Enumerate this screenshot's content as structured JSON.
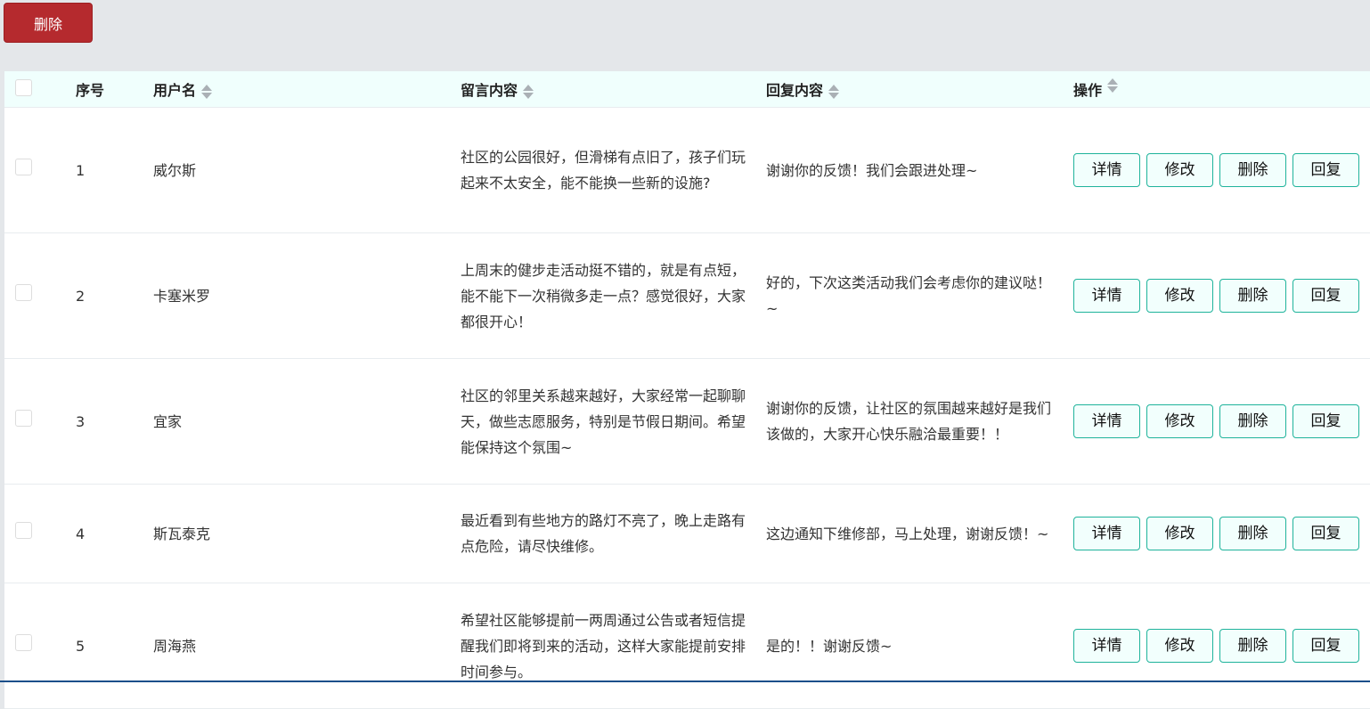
{
  "toolbar": {
    "delete_label": "删除"
  },
  "columns": {
    "index": "序号",
    "username": "用户名",
    "message": "留言内容",
    "reply": "回复内容",
    "actions": "操作"
  },
  "actions": {
    "detail": "详情",
    "edit": "修改",
    "delete": "删除",
    "reply": "回复"
  },
  "rows": [
    {
      "index": "1",
      "username": "威尔斯",
      "message": "社区的公园很好，但滑梯有点旧了，孩子们玩起来不太安全，能不能换一些新的设施?",
      "reply": "谢谢你的反馈！我们会跟进处理~",
      "height": 141
    },
    {
      "index": "2",
      "username": "卡塞米罗",
      "message": "上周末的健步走活动挺不错的，就是有点短，能不能下一次稍微多走一点？感觉很好，大家都很开心！",
      "reply": "好的，下次这类活动我们会考虑你的建议哒！~",
      "height": 141
    },
    {
      "index": "3",
      "username": "宜家",
      "message": "社区的邻里关系越来越好，大家经常一起聊聊天，做些志愿服务，特别是节假日期间。希望能保持这个氛围~",
      "reply": "谢谢你的反馈，让社区的氛围越来越好是我们该做的，大家开心快乐融洽最重要！！",
      "height": 141
    },
    {
      "index": "4",
      "username": "斯瓦泰克",
      "message": "最近看到有些地方的路灯不亮了，晚上走路有点危险，请尽快维修。",
      "reply": "这边通知下维修部，马上处理，谢谢反馈！~",
      "height": 111
    },
    {
      "index": "5",
      "username": "周海燕",
      "message": "希望社区能够提前一两周通过公告或者短信提醒我们即将到来的活动，这样大家能提前安排时间参与。",
      "reply": "是的！！谢谢反馈~",
      "height": 141
    }
  ]
}
